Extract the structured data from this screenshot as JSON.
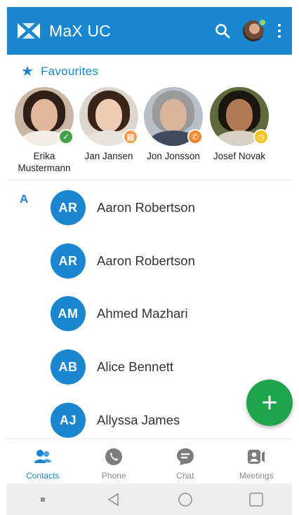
{
  "app_bar": {
    "title": "MaX UC",
    "logo_icon": "max-logo-icon",
    "search_icon": "search-icon",
    "more_icon": "more-vertical-icon",
    "accent": "#1a86cf"
  },
  "favourites": {
    "title": "Favourites",
    "items": [
      {
        "name": "Erika Mustermann",
        "status": "available",
        "status_icon": "check-icon",
        "status_color": "#43a047"
      },
      {
        "name": "Jan Jansen",
        "status": "in-meeting",
        "status_icon": "calendar-icon",
        "status_color": "#f39c4a"
      },
      {
        "name": "Jon Jonsson",
        "status": "on-call",
        "status_icon": "phone-icon",
        "status_color": "#f0872d"
      },
      {
        "name": "Josef Novak",
        "status": "away",
        "status_icon": "clock-icon",
        "status_color": "#f5c21b"
      }
    ]
  },
  "contacts": {
    "section_letter": "A",
    "items": [
      {
        "initials": "AR",
        "name": "Aaron Robertson"
      },
      {
        "initials": "AR",
        "name": "Aaron Robertson"
      },
      {
        "initials": "AM",
        "name": "Ahmed Mazhari"
      },
      {
        "initials": "AB",
        "name": "Alice Bennett"
      },
      {
        "initials": "AJ",
        "name": "Allyssa James"
      }
    ]
  },
  "fab": {
    "label": "+",
    "color": "#1ea44a"
  },
  "bottom_nav": {
    "tabs": [
      {
        "label": "Contacts",
        "icon": "contacts-icon",
        "active": true
      },
      {
        "label": "Phone",
        "icon": "phone-icon",
        "active": false
      },
      {
        "label": "Chat",
        "icon": "chat-icon",
        "active": false
      },
      {
        "label": "Meetings",
        "icon": "meetings-icon",
        "active": false
      }
    ]
  }
}
